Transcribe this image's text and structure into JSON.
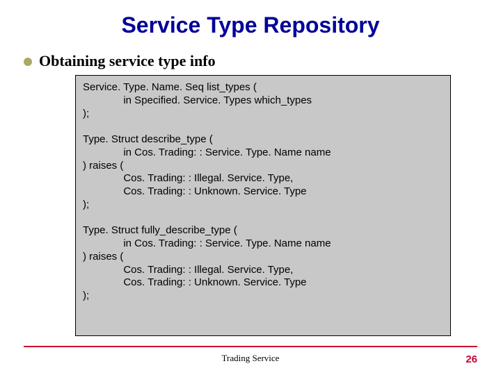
{
  "title": "Service Type Repository",
  "bullet": "Obtaining service type info",
  "code": "Service. Type. Name. Seq list_types (\n              in Specified. Service. Types which_types\n);\n\nType. Struct describe_type (\n              in Cos. Trading: : Service. Type. Name name\n) raises (\n              Cos. Trading: : Illegal. Service. Type,\n              Cos. Trading: : Unknown. Service. Type\n);\n\nType. Struct fully_describe_type (\n              in Cos. Trading: : Service. Type. Name name\n) raises (\n              Cos. Trading: : Illegal. Service. Type,\n              Cos. Trading: : Unknown. Service. Type\n);",
  "footer": {
    "center": "Trading Service",
    "page": "26"
  }
}
